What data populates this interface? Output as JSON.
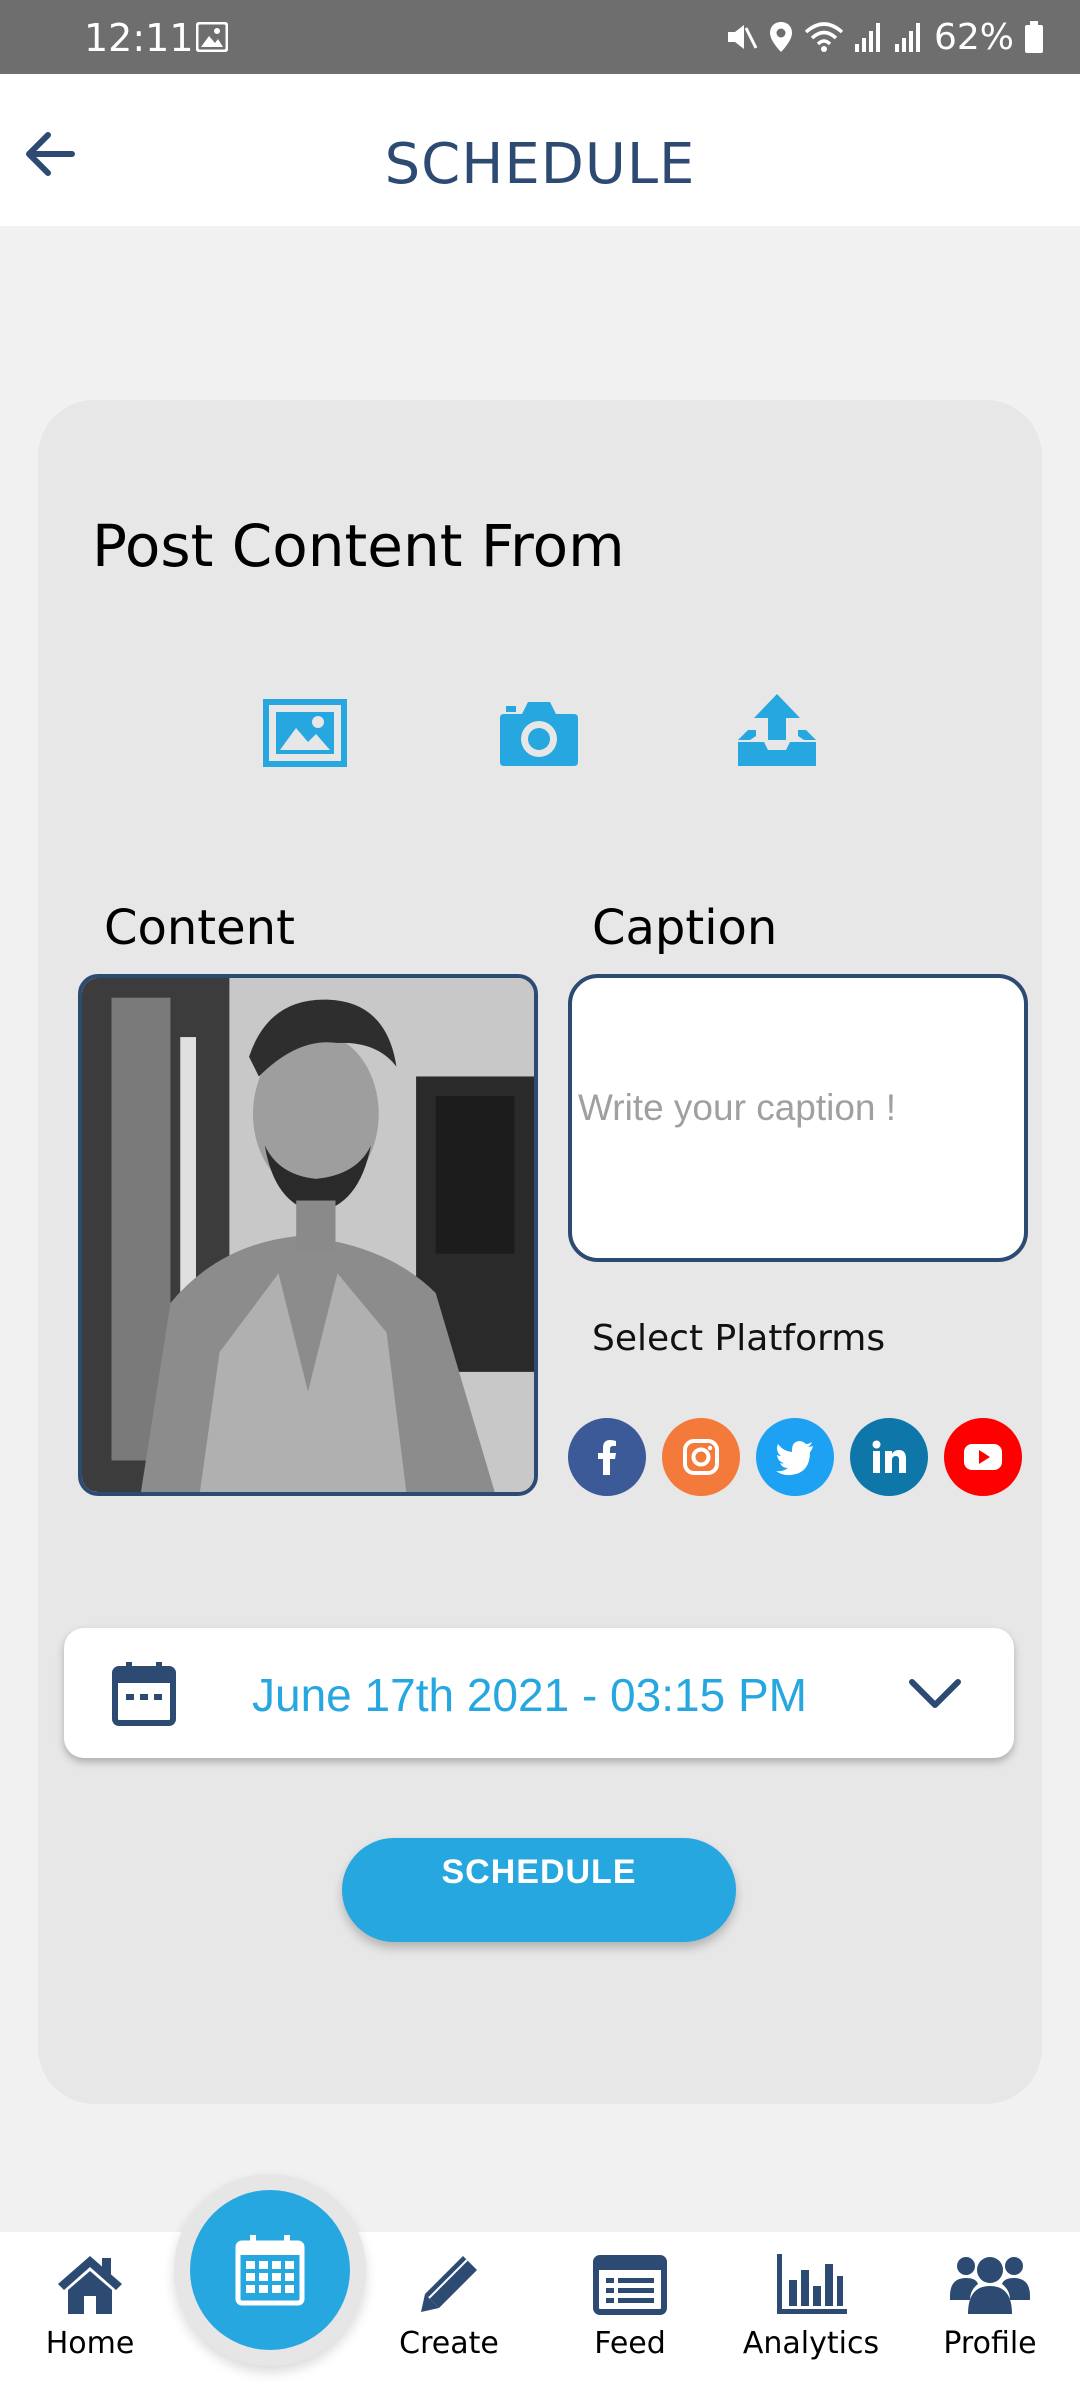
{
  "status_bar": {
    "time": "12:11",
    "battery": "62%",
    "icons": [
      "gallery-icon",
      "mute-icon",
      "location-icon",
      "wifi-icon",
      "signal-icon",
      "signal-icon",
      "battery-icon"
    ]
  },
  "app_bar": {
    "title": "SCHEDULE",
    "back_icon": "arrow-left-icon"
  },
  "card": {
    "section_title": "Post Content From",
    "sources": [
      {
        "name": "gallery",
        "icon": "image-icon"
      },
      {
        "name": "camera",
        "icon": "camera-icon"
      },
      {
        "name": "upload",
        "icon": "upload-icon"
      }
    ],
    "content_label": "Content",
    "caption_label": "Caption",
    "caption_placeholder": "Write your caption !",
    "caption_value": "",
    "platforms_label": "Select Platforms",
    "platforms": [
      {
        "name": "Facebook",
        "color": "#3c5a98"
      },
      {
        "name": "Instagram",
        "color": "#f47a3b"
      },
      {
        "name": "Twitter",
        "color": "#1da1f2"
      },
      {
        "name": "LinkedIn",
        "color": "#0e76a8"
      },
      {
        "name": "YouTube",
        "color": "#ff0000"
      }
    ],
    "date_value": "June 17th 2021 - 03:15 PM",
    "schedule_button": "SCHEDULE"
  },
  "bottom_nav": {
    "fab_icon": "calendar-icon",
    "items": [
      {
        "label": "Home",
        "icon": "home-icon"
      },
      {
        "label": "Create",
        "icon": "pencil-icon"
      },
      {
        "label": "Feed",
        "icon": "newspaper-icon"
      },
      {
        "label": "Analytics",
        "icon": "bar-chart-icon"
      },
      {
        "label": "Profile",
        "icon": "users-icon"
      }
    ]
  },
  "colors": {
    "accent": "#27a7e0",
    "navy": "#2c4a72",
    "card_bg": "#e7e7e7",
    "page_bg": "#f1f1f1"
  }
}
